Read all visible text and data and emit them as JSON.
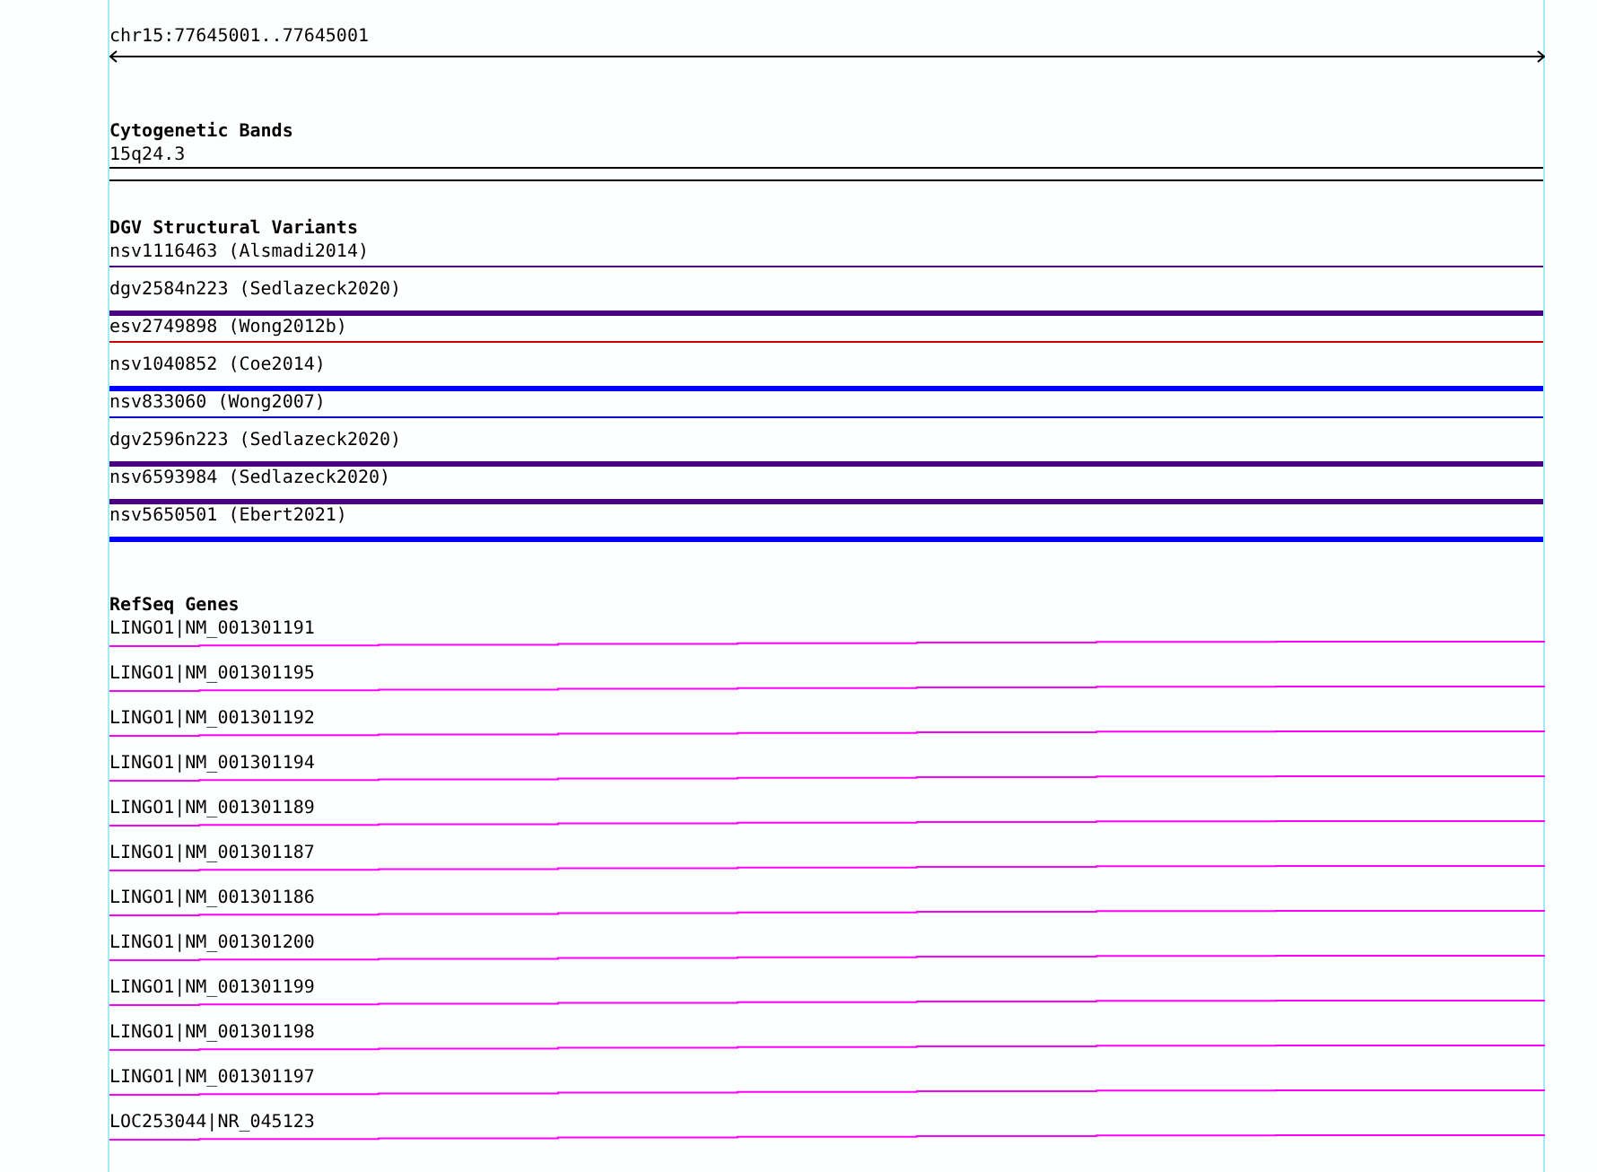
{
  "ruler": {
    "location": "chr15:77645001..77645001"
  },
  "cytogenetic_bands": {
    "title": "Cytogenetic Bands",
    "band": "15q24.3"
  },
  "dgv_structural_variants": {
    "title": "DGV Structural Variants",
    "items": [
      {
        "label": "nsv1116463 (Alsmadi2014)",
        "kind": "thin",
        "color": "#4b0082"
      },
      {
        "label": "dgv2584n223 (Sedlazeck2020)",
        "kind": "thick",
        "color": "#4b0082"
      },
      {
        "label": "esv2749898 (Wong2012b)",
        "kind": "thin",
        "color": "#cc0000"
      },
      {
        "label": "nsv1040852 (Coe2014)",
        "kind": "thick",
        "color": "#0000ff"
      },
      {
        "label": "nsv833060 (Wong2007)",
        "kind": "thin",
        "color": "#0000cc"
      },
      {
        "label": "dgv2596n223 (Sedlazeck2020)",
        "kind": "thick",
        "color": "#4b0082"
      },
      {
        "label": "nsv6593984 (Sedlazeck2020)",
        "kind": "thick",
        "color": "#4b0082"
      },
      {
        "label": "nsv5650501 (Ebert2021)",
        "kind": "thick",
        "color": "#0000ff"
      }
    ]
  },
  "refseq_genes": {
    "title": "RefSeq Genes",
    "items": [
      "LINGO1|NM_001301191",
      "LINGO1|NM_001301195",
      "LINGO1|NM_001301192",
      "LINGO1|NM_001301194",
      "LINGO1|NM_001301189",
      "LINGO1|NM_001301187",
      "LINGO1|NM_001301186",
      "LINGO1|NM_001301200",
      "LINGO1|NM_001301199",
      "LINGO1|NM_001301198",
      "LINGO1|NM_001301197",
      "LOC253044|NR_045123"
    ]
  }
}
